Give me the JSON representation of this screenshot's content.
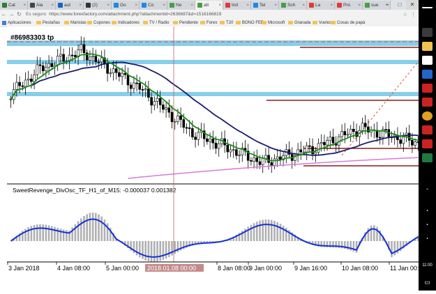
{
  "browser": {
    "tabs": [
      {
        "label": "Cal",
        "color": "#2e7d32"
      },
      {
        "label": "Ala",
        "color": "#444444"
      },
      {
        "label": "aut",
        "color": "#1565c0"
      },
      {
        "label": "(2)",
        "color": "#333333"
      },
      {
        "label": "Go",
        "color": "#1e88e5"
      },
      {
        "label": "Co",
        "color": "#1e88e5"
      },
      {
        "label": "Ne",
        "color": "#43a047"
      },
      {
        "label": "att",
        "color": "#43a047"
      },
      {
        "label": "Ind",
        "color": "#e53935"
      },
      {
        "label": "Tel",
        "color": "#1e88e5"
      },
      {
        "label": "Sch",
        "color": "#43a047"
      },
      {
        "label": "La",
        "color": "#e53935"
      },
      {
        "label": "Pro",
        "color": "#e53935"
      },
      {
        "label": "sue",
        "color": "#43a047"
      }
    ],
    "window_controls": {
      "minimize": "–",
      "maximize": "□",
      "close": "✕"
    },
    "address": {
      "back": "←",
      "forward": "→",
      "reload": "↻",
      "secure_label": "Es seguro",
      "url": "https://www.forexfactory.com/attachment.php?attachmentid=2636687&d=1516166819",
      "star": "☆",
      "menu": "⋮"
    },
    "bookmarks": [
      {
        "label": "Aplicaciones",
        "kind": "apps"
      },
      {
        "label": "Pestañas",
        "kind": "folder"
      },
      {
        "label": "Maristas",
        "kind": "folder"
      },
      {
        "label": "Cupones",
        "kind": "folder"
      },
      {
        "label": "Indicadores",
        "kind": "folder"
      },
      {
        "label": "TV / Radio",
        "kind": "folder"
      },
      {
        "label": "Pendiente",
        "kind": "folder"
      },
      {
        "label": "Forex",
        "kind": "folder"
      },
      {
        "label": "T20",
        "kind": "folder"
      },
      {
        "label": "BONO FED",
        "kind": "folder"
      },
      {
        "label": "Microsoft",
        "kind": "folder"
      },
      {
        "label": "Granada",
        "kind": "folder"
      },
      {
        "label": "Vuelos",
        "kind": "folder"
      },
      {
        "label": "Cosas de papá",
        "kind": "folder"
      }
    ]
  },
  "chart": {
    "order_label": "#86983303 tp",
    "indicator_label": "SweetRevenge_DivOsc_TF_H1_of_M15:  -0.000037 0.001382",
    "x_labels": [
      "3 Jan 2018",
      "4 Jan 08:00",
      "5 Jan 00:00",
      "2018.01.08 00:00",
      "8 Jan 08:00",
      "9 Jan 00:00",
      "9 Jan 16:00",
      "10 Jan 08:00",
      "11 Jan 00:"
    ],
    "colors": {
      "bull": "#ffffff",
      "bear": "#000000",
      "ma_fast": "#1a8a1a",
      "ma_slow": "#1c1c6e",
      "ma_long": "#d97ad9",
      "zone": "#87ceeb",
      "level": "#8b1a1a",
      "tp_line": "#e05030",
      "osc_line": "#1530d8",
      "osc_hist": "#b0b0b0",
      "crosshair_label_bg": "#c48a8a"
    }
  },
  "taskbar": {
    "clock": "11:00",
    "date": "17/01/2018"
  }
}
